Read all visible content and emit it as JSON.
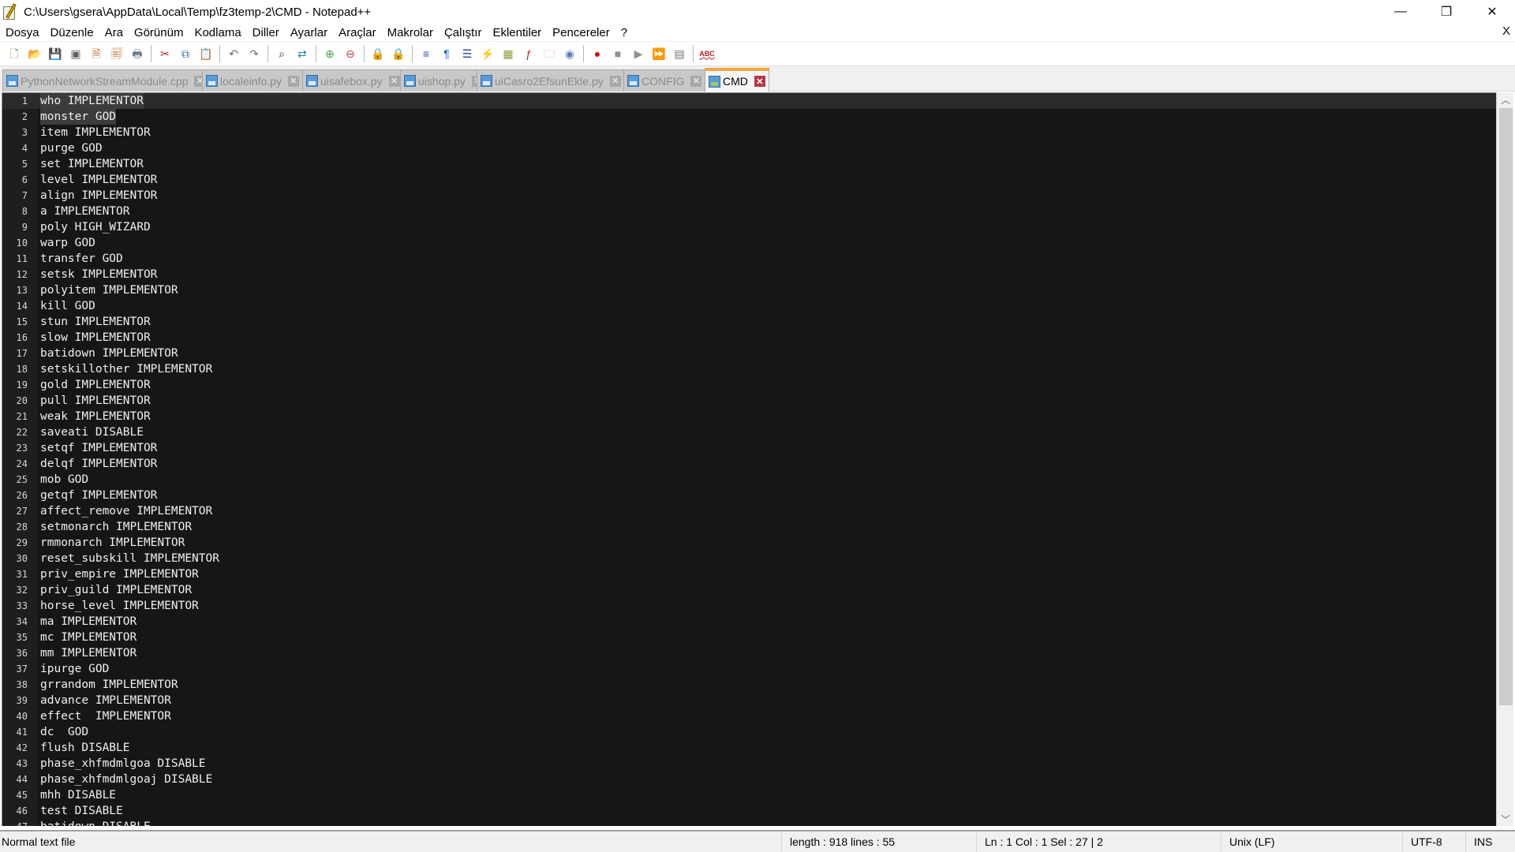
{
  "window": {
    "title": "C:\\Users\\gsera\\AppData\\Local\\Temp\\fz3temp-2\\CMD - Notepad++",
    "controls": {
      "minimize": "—",
      "maximize": "❐",
      "close": "✕"
    }
  },
  "menu": {
    "items": [
      "Dosya",
      "Düzenle",
      "Ara",
      "Görünüm",
      "Kodlama",
      "Diller",
      "Ayarlar",
      "Araçlar",
      "Makrolar",
      "Çalıştır",
      "Eklentiler",
      "Pencereler",
      "?"
    ],
    "close_doc": "X"
  },
  "toolbar": {
    "buttons": [
      {
        "name": "new-file",
        "glyph": "🗋",
        "color": "#4a9a3a"
      },
      {
        "name": "open-file",
        "glyph": "📂",
        "color": "#d8a020"
      },
      {
        "name": "save",
        "glyph": "💾",
        "color": "#606060"
      },
      {
        "name": "save-all",
        "glyph": "▣",
        "color": "#606060"
      },
      {
        "name": "close",
        "glyph": "🗎",
        "color": "#d06020"
      },
      {
        "name": "close-all",
        "glyph": "🗐",
        "color": "#d06020"
      },
      {
        "name": "print",
        "glyph": "🖶",
        "color": "#6a7a8a"
      },
      {
        "sep": true
      },
      {
        "name": "cut",
        "glyph": "✂",
        "color": "#b02020"
      },
      {
        "name": "copy",
        "glyph": "⧉",
        "color": "#3070c0"
      },
      {
        "name": "paste",
        "glyph": "📋",
        "color": "#c08030"
      },
      {
        "sep": true
      },
      {
        "name": "undo",
        "glyph": "↶",
        "color": "#707070"
      },
      {
        "name": "redo",
        "glyph": "↷",
        "color": "#707070"
      },
      {
        "sep": true
      },
      {
        "name": "find",
        "glyph": "⌕",
        "color": "#303030"
      },
      {
        "name": "replace",
        "glyph": "⇄",
        "color": "#2080b0"
      },
      {
        "sep": true
      },
      {
        "name": "zoom-in",
        "glyph": "⊕",
        "color": "#40a040"
      },
      {
        "name": "zoom-out",
        "glyph": "⊖",
        "color": "#c04040"
      },
      {
        "sep": true
      },
      {
        "name": "sync-vertical",
        "glyph": "🔒",
        "color": "#d8a020"
      },
      {
        "name": "sync-horizontal",
        "glyph": "🔒",
        "color": "#d8a020"
      },
      {
        "sep": true
      },
      {
        "name": "word-wrap",
        "glyph": "≡",
        "color": "#2050a0"
      },
      {
        "name": "show-all-chars",
        "glyph": "¶",
        "color": "#2060c0"
      },
      {
        "name": "indent-guide",
        "glyph": "☰",
        "color": "#2040a0"
      },
      {
        "name": "udl",
        "glyph": "⚡",
        "color": "#d8a020"
      },
      {
        "name": "doc-map",
        "glyph": "▦",
        "color": "#8aa040"
      },
      {
        "name": "function-list",
        "glyph": "ƒ",
        "color": "#c02020"
      },
      {
        "name": "folder-workspace",
        "glyph": "🗀",
        "color": "#e09aa0"
      },
      {
        "name": "monitoring",
        "glyph": "◉",
        "color": "#6080b0"
      },
      {
        "sep": true
      },
      {
        "name": "macro-record",
        "glyph": "●",
        "color": "#d01010"
      },
      {
        "name": "macro-stop",
        "glyph": "■",
        "color": "#909090"
      },
      {
        "name": "macro-play",
        "glyph": "▶",
        "color": "#909090"
      },
      {
        "name": "macro-run-multiple",
        "glyph": "⏩",
        "color": "#3060c0"
      },
      {
        "name": "macro-save",
        "glyph": "▤",
        "color": "#707070"
      },
      {
        "sep": true
      },
      {
        "name": "spell-check",
        "glyph": "ABC",
        "color": "#b02020"
      }
    ]
  },
  "tabs": [
    {
      "label": "PythonNetworkStreamModule.cpp",
      "active": false
    },
    {
      "label": "localeinfo.py",
      "active": false
    },
    {
      "label": "uisafebox.py",
      "active": false
    },
    {
      "label": "uishop.py",
      "active": false
    },
    {
      "label": "uiCasro2EfsunEkle.py",
      "active": false
    },
    {
      "label": "CONFIG",
      "active": false
    },
    {
      "label": "CMD",
      "active": true
    }
  ],
  "tab_close_glyph": "✕",
  "editor": {
    "current_line": 1,
    "lines": [
      "who IMPLEMENTOR",
      "monster GOD",
      "item IMPLEMENTOR",
      "purge GOD",
      "set IMPLEMENTOR",
      "level IMPLEMENTOR",
      "align IMPLEMENTOR",
      "a IMPLEMENTOR",
      "poly HIGH_WIZARD",
      "warp GOD",
      "transfer GOD",
      "setsk IMPLEMENTOR",
      "polyitem IMPLEMENTOR",
      "kill GOD",
      "stun IMPLEMENTOR",
      "slow IMPLEMENTOR",
      "batidown IMPLEMENTOR",
      "setskillother IMPLEMENTOR",
      "gold IMPLEMENTOR",
      "pull IMPLEMENTOR",
      "weak IMPLEMENTOR",
      "saveati DISABLE",
      "setqf IMPLEMENTOR",
      "delqf IMPLEMENTOR",
      "mob GOD",
      "getqf IMPLEMENTOR",
      "affect_remove IMPLEMENTOR",
      "setmonarch IMPLEMENTOR",
      "rmmonarch IMPLEMENTOR",
      "reset_subskill IMPLEMENTOR",
      "priv_empire IMPLEMENTOR",
      "priv_guild IMPLEMENTOR",
      "horse_level IMPLEMENTOR",
      "ma IMPLEMENTOR",
      "mc IMPLEMENTOR",
      "mm IMPLEMENTOR",
      "ipurge GOD",
      "grrandom IMPLEMENTOR",
      "advance IMPLEMENTOR",
      "effect  IMPLEMENTOR",
      "dc  GOD",
      "flush DISABLE",
      "phase_xhfmdmlgoa DISABLE",
      "phase_xhfmdmlgoaj DISABLE",
      "mhh DISABLE",
      "test DISABLE",
      "batidown DISABLE"
    ],
    "selected_lines": [
      1,
      2
    ]
  },
  "scrollbar": {
    "up": "︿",
    "down": "﹀",
    "visible_fraction": 0.85,
    "position": 0
  },
  "status": {
    "file_type": "Normal text file",
    "length_lines": "length : 918    lines : 55",
    "position": "Ln : 1    Col : 1    Sel : 27 | 2",
    "eol": "Unix (LF)",
    "encoding": "UTF-8",
    "mode": "INS"
  }
}
